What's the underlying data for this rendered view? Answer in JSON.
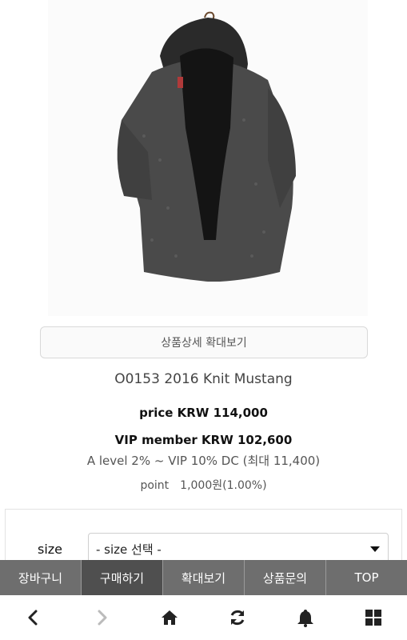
{
  "product": {
    "zoom_detail_label": "상품상세 확대보기",
    "name": "O0153 2016 Knit Mustang",
    "price_line": "price KRW 114,000",
    "vip_line": "VIP member KRW 102,600",
    "discount_line": "A level 2% ~ VIP 10% DC (최대 11,400)",
    "point_label": "point",
    "point_value": "1,000원(1.00%)"
  },
  "options": {
    "size_label": "size",
    "size_selected": "- size 선택 -"
  },
  "action_bar": [
    {
      "label": "장바구니"
    },
    {
      "label": "구매하기"
    },
    {
      "label": "확대보기"
    },
    {
      "label": "상품문의"
    },
    {
      "label": "TOP"
    }
  ],
  "bottom_nav": {
    "icons": [
      "back-arrow-icon",
      "forward-arrow-icon",
      "home-icon",
      "refresh-icon",
      "bell-icon",
      "grid-icon"
    ],
    "icon_color": "#222222",
    "disabled_color": "#bbbbbb"
  },
  "colors": {
    "action_bar_bg": "#6e6e6e",
    "action_bar_active_bg": "#4f4f4f"
  }
}
